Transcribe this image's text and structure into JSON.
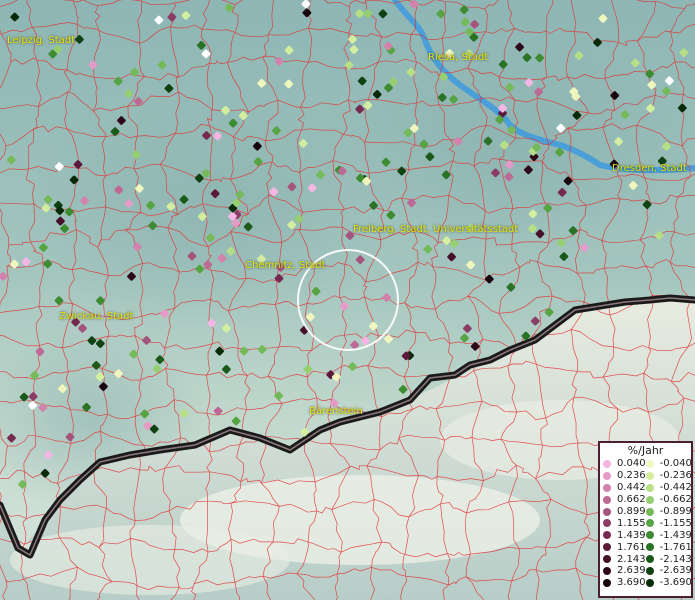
{
  "map": {
    "labels": [
      {
        "id": "leipzig",
        "text": "Leipzig, Stadt"
      },
      {
        "id": "riesa",
        "text": "Riesa, Stadt"
      },
      {
        "id": "dresden",
        "text": "Dresden, Stadt"
      },
      {
        "id": "freiberg",
        "text": "Freiberg, Stadt, Universitätsstadt"
      },
      {
        "id": "chemnitz",
        "text": "Chemnitz, Stadt"
      },
      {
        "id": "zwickau",
        "text": "Zwickau, Stadt"
      },
      {
        "id": "baerenstein",
        "text": "Bärenstein"
      }
    ],
    "colors": {
      "terrain": "#9fc0bc",
      "boundary": "#e03030",
      "river": "#4a9fd8",
      "border": "#1a1a1a"
    }
  },
  "legend": {
    "title": "%/Jahr",
    "positive": [
      {
        "value": "0.040",
        "color": "#f4b6e4"
      },
      {
        "value": "0.236",
        "color": "#e59bc8"
      },
      {
        "value": "0.442",
        "color": "#d183ad"
      },
      {
        "value": "0.662",
        "color": "#bc6a95"
      },
      {
        "value": "0.899",
        "color": "#a4557e"
      },
      {
        "value": "1.155",
        "color": "#8c3d66"
      },
      {
        "value": "1.439",
        "color": "#74294f"
      },
      {
        "value": "1.761",
        "color": "#5c1a3b"
      },
      {
        "value": "2.143",
        "color": "#461029"
      },
      {
        "value": "2.639",
        "color": "#2e0819"
      },
      {
        "value": "3.690",
        "color": "#18030c"
      }
    ],
    "negative": [
      {
        "value": "-0.040",
        "color": "#f0f7be"
      },
      {
        "value": "-0.236",
        "color": "#d4eea0"
      },
      {
        "value": "-0.442",
        "color": "#b6df88"
      },
      {
        "value": "-0.662",
        "color": "#96cf72"
      },
      {
        "value": "-0.899",
        "color": "#74ba5a"
      },
      {
        "value": "-1.155",
        "color": "#56a444"
      },
      {
        "value": "-1.439",
        "color": "#3d8c34"
      },
      {
        "value": "-1.761",
        "color": "#2a7226"
      },
      {
        "value": "-2.143",
        "color": "#1c5a1c"
      },
      {
        "value": "-2.639",
        "color": "#0f4212"
      },
      {
        "value": "-3.690",
        "color": "#062a08"
      }
    ]
  }
}
